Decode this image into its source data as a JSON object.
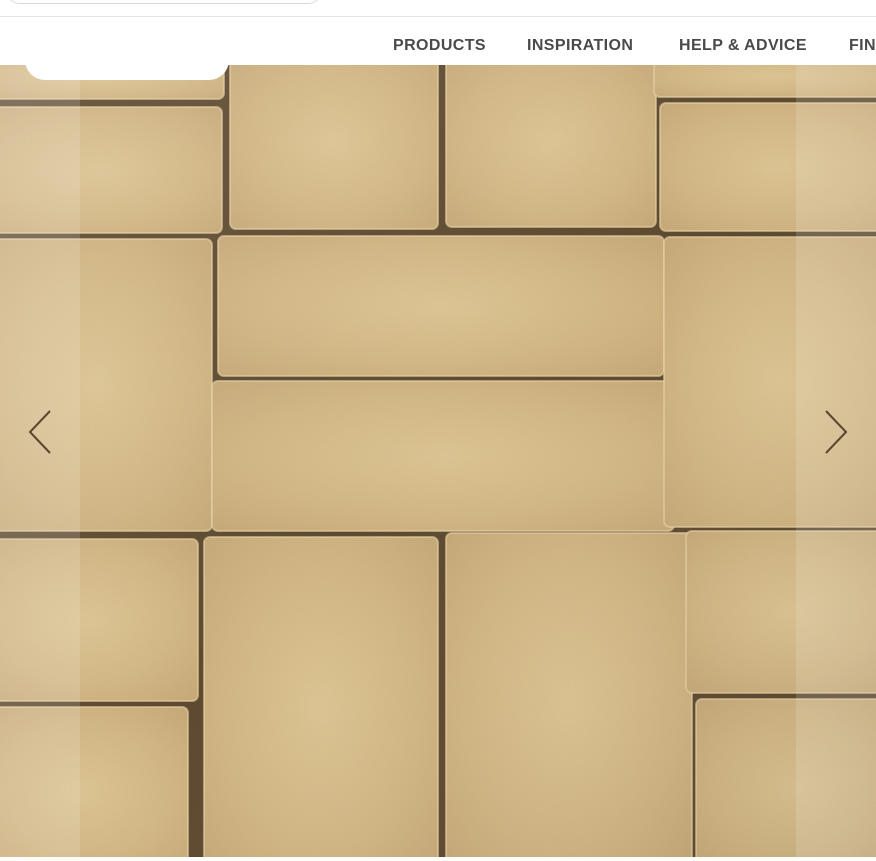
{
  "nav": {
    "items": [
      {
        "label": "PRODUCTS"
      },
      {
        "label": "INSPIRATION"
      },
      {
        "label": "HELP & ADVICE"
      },
      {
        "label": "FIN"
      }
    ]
  },
  "hero": {
    "prev_icon": "chevron-left-icon",
    "next_icon": "chevron-right-icon"
  },
  "colors": {
    "nav_text": "#4a4a4a",
    "paver_base": "#d9be8a",
    "joint": "#5e4a30"
  }
}
